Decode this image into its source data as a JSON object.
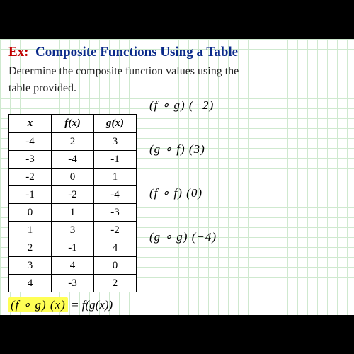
{
  "title_prefix": "Ex:",
  "title_main": "Composite Functions Using a Table",
  "subtitle_line1": "Determine the composite function values using the",
  "subtitle_line2": "table provided.",
  "table": {
    "headers": [
      "x",
      "f(x)",
      "g(x)"
    ],
    "rows": [
      [
        "-4",
        "2",
        "3"
      ],
      [
        "-3",
        "-4",
        "-1"
      ],
      [
        "-2",
        "0",
        "1"
      ],
      [
        "-1",
        "-2",
        "-4"
      ],
      [
        "0",
        "1",
        "-3"
      ],
      [
        "1",
        "3",
        "-2"
      ],
      [
        "2",
        "-1",
        "4"
      ],
      [
        "3",
        "4",
        "0"
      ],
      [
        "4",
        "-3",
        "2"
      ]
    ]
  },
  "problems": [
    "(f ∘ g) (−2)",
    "(g ∘ f) (3)",
    "(f ∘ f) (0)",
    "(g ∘ g) (−4)"
  ],
  "formula_lhs": "(f ∘ g) (x)",
  "formula_rhs": "= f(g(x))",
  "chart_data": {
    "type": "table",
    "columns": [
      "x",
      "f(x)",
      "g(x)"
    ],
    "data": [
      {
        "x": -4,
        "f": 2,
        "g": 3
      },
      {
        "x": -3,
        "f": -4,
        "g": -1
      },
      {
        "x": -2,
        "f": 0,
        "g": 1
      },
      {
        "x": -1,
        "f": -2,
        "g": -4
      },
      {
        "x": 0,
        "f": 1,
        "g": -3
      },
      {
        "x": 1,
        "f": 3,
        "g": -2
      },
      {
        "x": 2,
        "f": -1,
        "g": 4
      },
      {
        "x": 3,
        "f": 4,
        "g": 0
      },
      {
        "x": 4,
        "f": -3,
        "g": 2
      }
    ]
  }
}
